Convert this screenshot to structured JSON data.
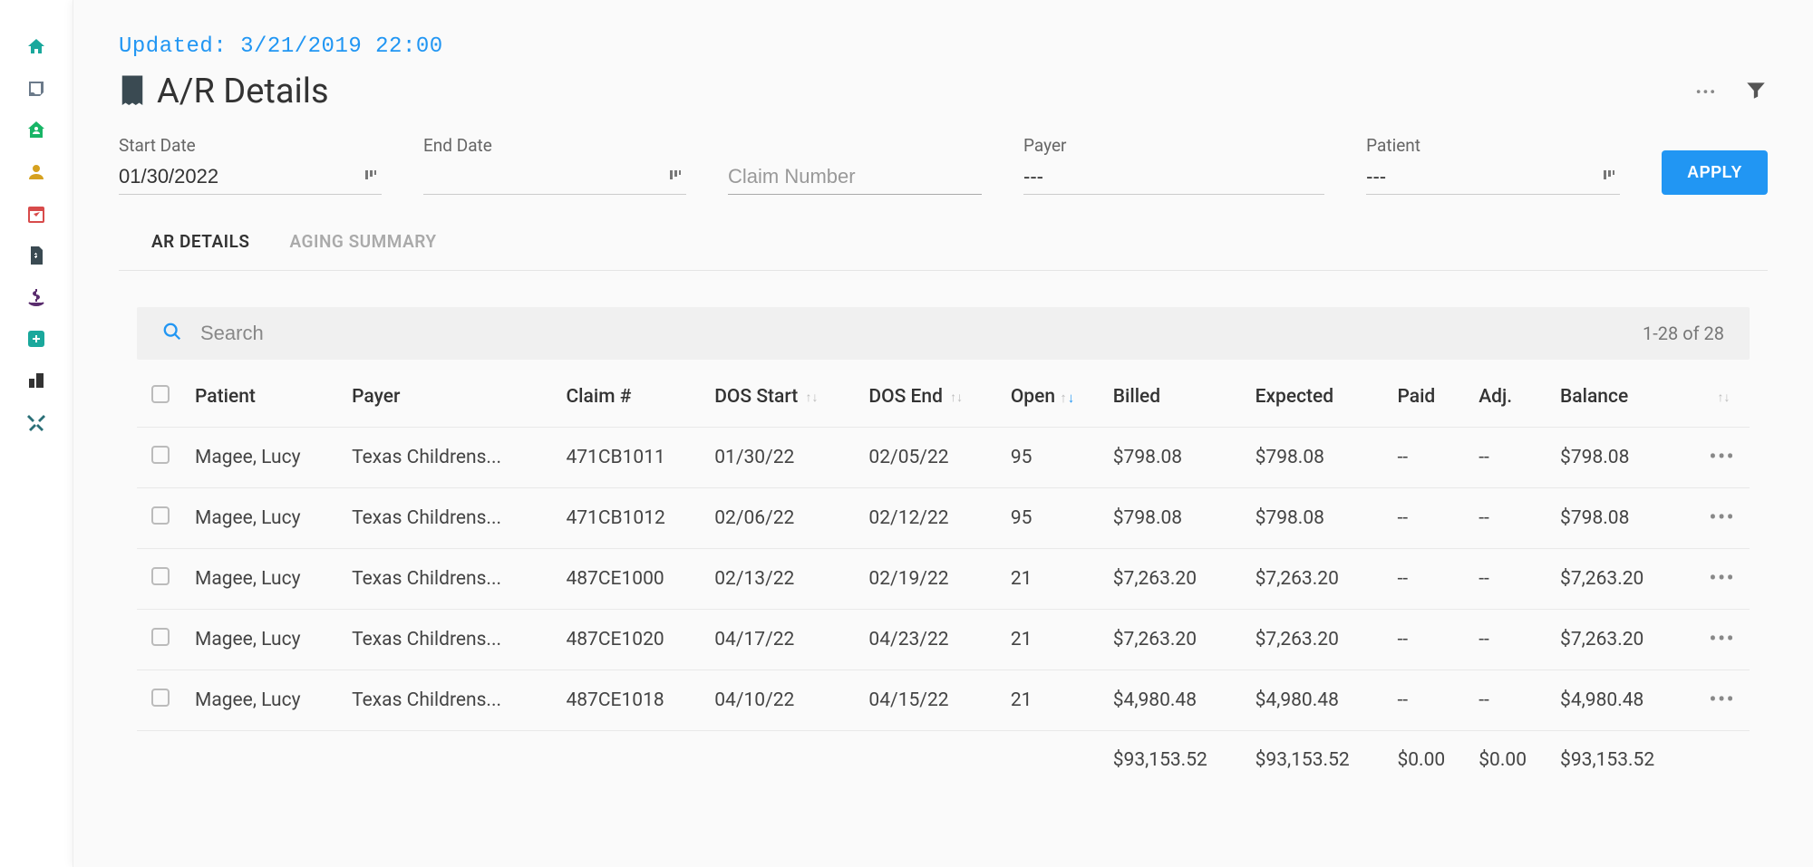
{
  "updated_text": "Updated: 3/21/2019 22:00",
  "page_title": "A/R Details",
  "filters": {
    "start_date": {
      "label": "Start Date",
      "value": "01/30/2022"
    },
    "end_date": {
      "label": "End Date",
      "value": ""
    },
    "claim_number": {
      "placeholder": "Claim Number",
      "value": ""
    },
    "payer": {
      "label": "Payer",
      "value": "---"
    },
    "patient": {
      "label": "Patient",
      "value": "---"
    },
    "apply_label": "APPLY"
  },
  "tabs": {
    "ar_details": "AR DETAILS",
    "aging_summary": "AGING SUMMARY"
  },
  "search": {
    "placeholder": "Search",
    "count": "1-28 of 28"
  },
  "columns": {
    "patient": "Patient",
    "payer": "Payer",
    "claim": "Claim #",
    "dos_start": "DOS Start",
    "dos_end": "DOS End",
    "open": "Open",
    "billed": "Billed",
    "expected": "Expected",
    "paid": "Paid",
    "adj": "Adj.",
    "balance": "Balance"
  },
  "rows": [
    {
      "patient": "Magee, Lucy",
      "payer": "Texas Childrens...",
      "claim": "471CB1011",
      "dos_start": "01/30/22",
      "dos_end": "02/05/22",
      "open": "95",
      "billed": "$798.08",
      "expected": "$798.08",
      "paid": "--",
      "adj": "--",
      "balance": "$798.08"
    },
    {
      "patient": "Magee, Lucy",
      "payer": "Texas Childrens...",
      "claim": "471CB1012",
      "dos_start": "02/06/22",
      "dos_end": "02/12/22",
      "open": "95",
      "billed": "$798.08",
      "expected": "$798.08",
      "paid": "--",
      "adj": "--",
      "balance": "$798.08"
    },
    {
      "patient": "Magee, Lucy",
      "payer": "Texas Childrens...",
      "claim": "487CE1000",
      "dos_start": "02/13/22",
      "dos_end": "02/19/22",
      "open": "21",
      "billed": "$7,263.20",
      "expected": "$7,263.20",
      "paid": "--",
      "adj": "--",
      "balance": "$7,263.20"
    },
    {
      "patient": "Magee, Lucy",
      "payer": "Texas Childrens...",
      "claim": "487CE1020",
      "dos_start": "04/17/22",
      "dos_end": "04/23/22",
      "open": "21",
      "billed": "$7,263.20",
      "expected": "$7,263.20",
      "paid": "--",
      "adj": "--",
      "balance": "$7,263.20"
    },
    {
      "patient": "Magee, Lucy",
      "payer": "Texas Childrens...",
      "claim": "487CE1018",
      "dos_start": "04/10/22",
      "dos_end": "04/15/22",
      "open": "21",
      "billed": "$4,980.48",
      "expected": "$4,980.48",
      "paid": "--",
      "adj": "--",
      "balance": "$4,980.48"
    }
  ],
  "totals": {
    "billed": "$93,153.52",
    "expected": "$93,153.52",
    "paid": "$0.00",
    "adj": "$0.00",
    "balance": "$93,153.52"
  }
}
